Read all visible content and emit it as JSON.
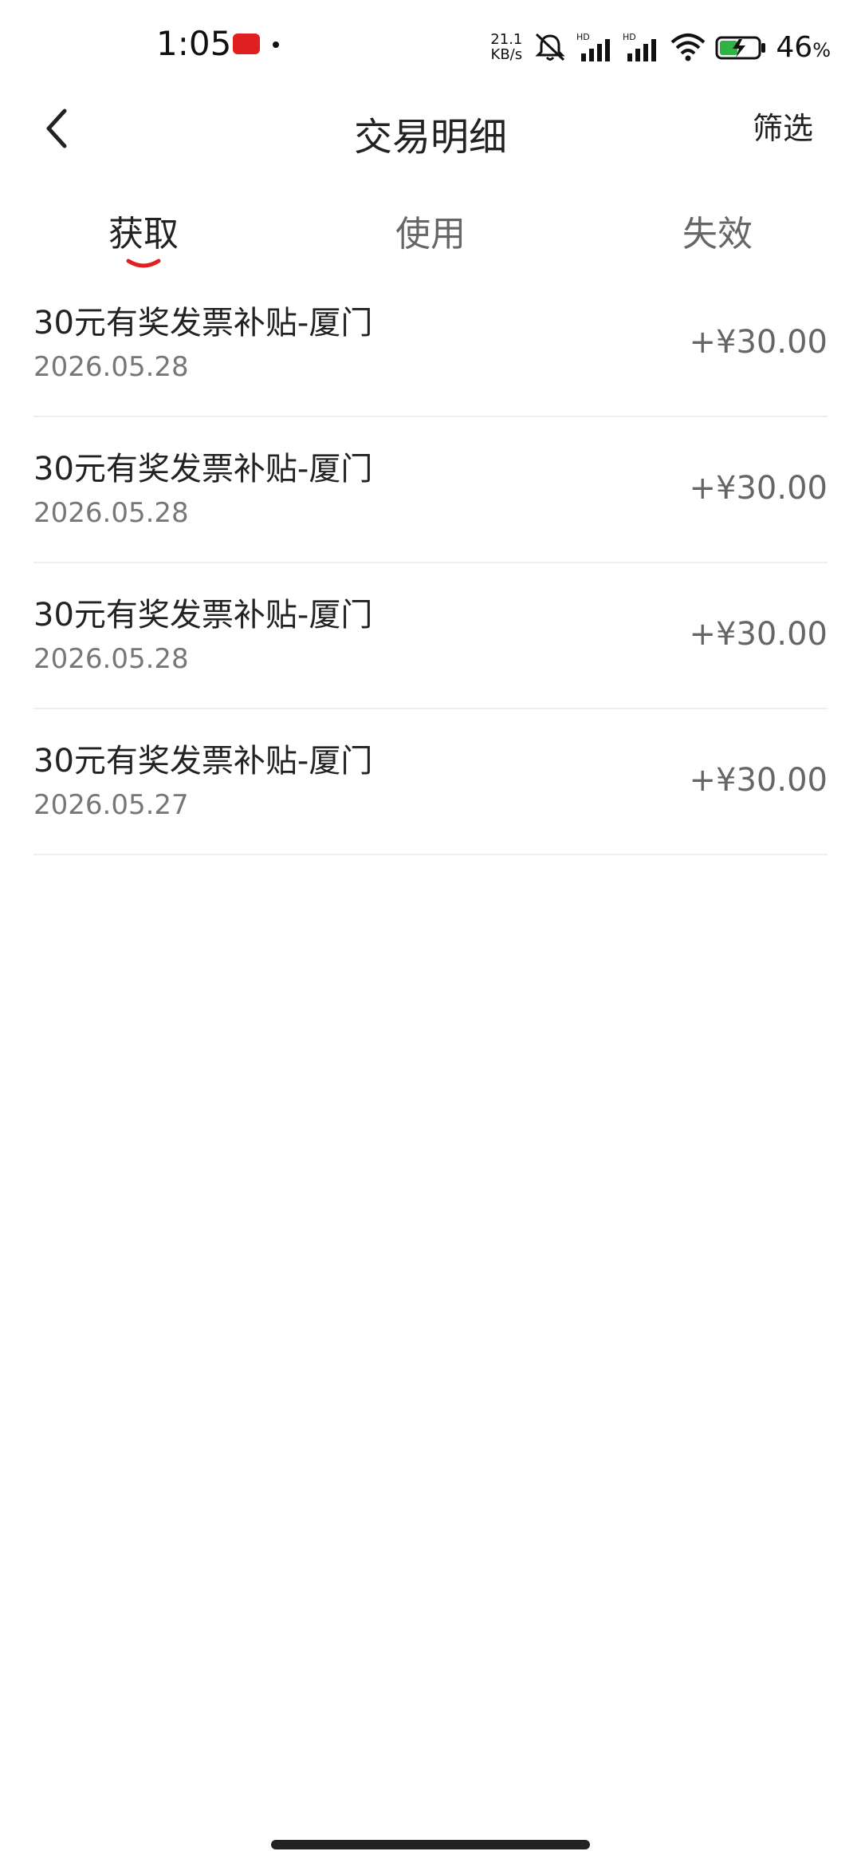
{
  "status_bar": {
    "time": "1:05",
    "net_speed_value": "21.1",
    "net_speed_unit": "KB/s",
    "battery_percent": "46",
    "battery_unit": "%"
  },
  "header": {
    "title": "交易明细",
    "filter_label": "筛选"
  },
  "tabs": [
    {
      "label": "获取",
      "active": true
    },
    {
      "label": "使用",
      "active": false
    },
    {
      "label": "失效",
      "active": false
    }
  ],
  "transactions": [
    {
      "title": "30元有奖发票补贴-厦门",
      "date": "2026.05.28",
      "amount": "+¥30.00"
    },
    {
      "title": "30元有奖发票补贴-厦门",
      "date": "2026.05.28",
      "amount": "+¥30.00"
    },
    {
      "title": "30元有奖发票补贴-厦门",
      "date": "2026.05.28",
      "amount": "+¥30.00"
    },
    {
      "title": "30元有奖发票补贴-厦门",
      "date": "2026.05.27",
      "amount": "+¥30.00"
    }
  ],
  "colors": {
    "accent": "#e02020",
    "text_primary": "#222222",
    "text_secondary": "#777777"
  },
  "icons": {
    "back": "chevron-left-icon",
    "silent": "bell-off-icon",
    "signal": "signal-icon",
    "wifi": "wifi-icon",
    "battery": "battery-charging-icon"
  }
}
